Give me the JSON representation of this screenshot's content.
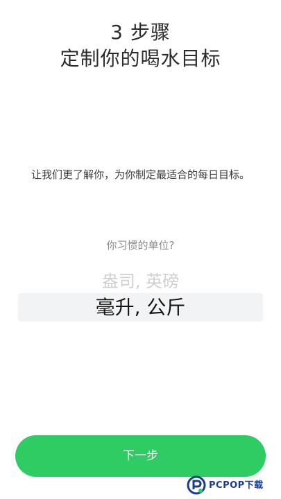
{
  "title": {
    "line1": "3 步骤",
    "line2": "定制你的喝水目标"
  },
  "intro_text": "让我们更了解你，为你制定最适合的每日目标。",
  "question": "你习惯的单位?",
  "unit_picker": {
    "options": [
      "盎司, 英磅",
      "毫升, 公斤"
    ],
    "selected": "毫升, 公斤"
  },
  "next_button_label": "下一步",
  "watermark": {
    "text": "PCPOP下载"
  },
  "colors": {
    "accent": "#2ecc62",
    "selection_bg": "#f2f3f4",
    "watermark_blue": "#1a3c8c"
  }
}
